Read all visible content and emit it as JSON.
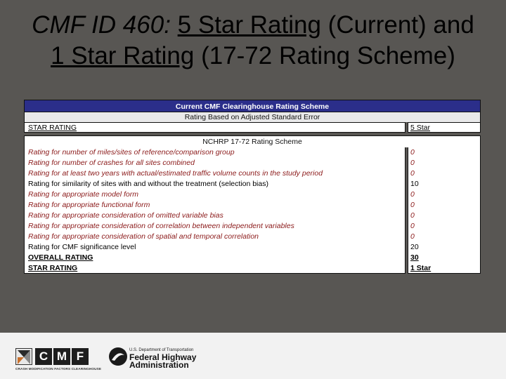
{
  "title": {
    "line1_a": "CMF ID 460: ",
    "line1_b": "5 Star Rating",
    "line1_c": " (Current) and",
    "line2_a": "1 Star Rating",
    "line2_b": " (17-72 Rating Scheme)"
  },
  "current_scheme": {
    "header": "Current CMF Clearinghouse Rating Scheme",
    "subheader": "Rating Based on Adjusted Standard Error",
    "star_label": "STAR RATING",
    "star_value": "5 Star"
  },
  "nchrp_scheme": {
    "header": "NCHRP 17-72 Rating Scheme",
    "rows": [
      {
        "label": "Rating for number of miles/sites of reference/comparison group",
        "value": "0"
      },
      {
        "label": "Rating for number of crashes for all sites combined",
        "value": "0"
      },
      {
        "label": "Rating for at least two years with actual/estimated traffic volume counts in the study period",
        "value": "0"
      },
      {
        "label": "Rating for similarity of sites with and without the treatment (selection bias)",
        "value": "10"
      },
      {
        "label": "Rating for appropriate model form",
        "value": "0"
      },
      {
        "label": "Rating for appropriate functional form",
        "value": "0"
      },
      {
        "label": "Rating for appropriate consideration of omitted variable bias",
        "value": "0"
      },
      {
        "label": "Rating for appropriate consideration of correlation between independent variables",
        "value": "0"
      },
      {
        "label": "Rating for appropriate consideration of spatial and temporal correlation",
        "value": "0"
      },
      {
        "label": "Rating for CMF significance level",
        "value": "20"
      }
    ],
    "overall_label": "OVERALL RATING",
    "overall_value": "30",
    "star_label": "STAR RATING",
    "star_value": "1 Star"
  },
  "footer": {
    "cmf_letters": [
      "C",
      "M",
      "F"
    ],
    "cmf_caption": "CRASH MODIFICATION FACTORS CLEARINGHOUSE",
    "fhwa_dept": "U.S. Department of Transportation",
    "fhwa_name_1": "Federal Highway",
    "fhwa_name_2": "Administration"
  },
  "colors": {
    "background": "#585653",
    "header_bar": "#2b2e8a",
    "highlight_text": "#8b1a1a",
    "footer": "#f2f2f2"
  }
}
